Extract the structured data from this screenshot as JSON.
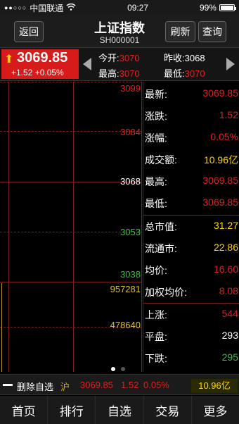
{
  "status": {
    "carrier": "中国联通",
    "time": "09:27",
    "battery": "99%"
  },
  "header": {
    "back": "返回",
    "title": "上证指数",
    "code": "SH000001",
    "refresh": "刷新",
    "query": "查询"
  },
  "price": {
    "current": "3069.85",
    "change": "+1.52 +0.05%"
  },
  "quote": {
    "open_label": "今开:",
    "open": "3070",
    "prev_label": "昨收:",
    "prev": "3068",
    "high_label": "最高:",
    "high": "3070",
    "low_label": "最低:",
    "low": "3070"
  },
  "chart": {
    "scales": [
      "3099",
      "3084",
      "3068",
      "3053",
      "3038"
    ],
    "vol_scales": [
      "957281",
      "478640"
    ],
    "colors": {
      "up": "#e02020",
      "flat": "#ffffff",
      "down": "#3fbf3f",
      "vol": "#d8c030"
    }
  },
  "stats": [
    {
      "k": "最新:",
      "v": "3069.85",
      "c": "#e02020"
    },
    {
      "k": "涨跌:",
      "v": "1.52",
      "c": "#e02020"
    },
    {
      "k": "涨幅:",
      "v": "0.05%",
      "c": "#e02020"
    },
    {
      "k": "成交额:",
      "v": "10.96亿",
      "c": "#ffd200"
    },
    {
      "k": "最高:",
      "v": "3069.85",
      "c": "#e02020"
    },
    {
      "k": "最低:",
      "v": "3069.85",
      "c": "#e02020"
    },
    {
      "k": "总市值:",
      "v": "31.27",
      "c": "#ffd200"
    },
    {
      "k": "流通市:",
      "v": "22.86",
      "c": "#ffd200"
    },
    {
      "k": "均价:",
      "v": "16.60",
      "c": "#e02020"
    },
    {
      "k": "加权均价:",
      "v": "8.08",
      "c": "#e02020"
    },
    {
      "k": "上涨:",
      "v": "544",
      "c": "#e02020"
    },
    {
      "k": "平盘:",
      "v": "293",
      "c": "#ffffff"
    },
    {
      "k": "下跌:",
      "v": "295",
      "c": "#3fbf3f"
    }
  ],
  "fav": {
    "label": "删除自选",
    "market": "沪",
    "price": "3069.85",
    "chg": "1.52",
    "pct": "0.05%",
    "amount": "10.96亿"
  },
  "tabs": [
    "首页",
    "排行",
    "自选",
    "交易",
    "更多"
  ]
}
